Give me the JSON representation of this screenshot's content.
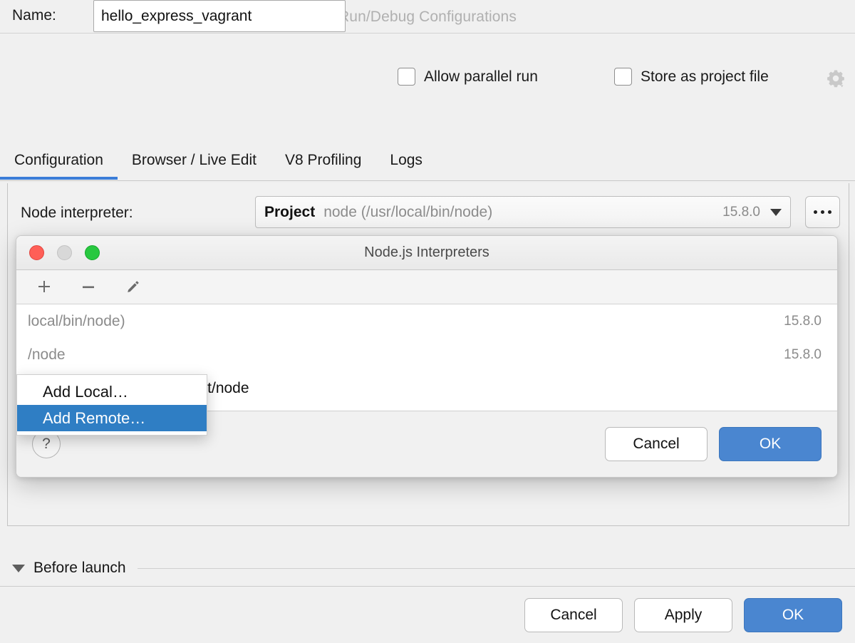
{
  "window": {
    "title": "Run/Debug Configurations"
  },
  "name_row": {
    "label": "Name:",
    "value": "hello_express_vagrant",
    "placeholder": "",
    "allow_parallel_run": "Allow parallel run",
    "store_as_project_file": "Store as project file",
    "gear_icon": "gear-icon"
  },
  "tabs": [
    {
      "label": "Configuration",
      "active": true
    },
    {
      "label": "Browser / Live Edit",
      "active": false
    },
    {
      "label": "V8 Profiling",
      "active": false
    },
    {
      "label": "Logs",
      "active": false
    }
  ],
  "configuration": {
    "node_interpreter_label": "Node interpreter:",
    "interpreter_scope": "Project",
    "interpreter_path": "node (/usr/local/bin/node)",
    "interpreter_version": "15.8.0",
    "browse_button": "...",
    "dropdown_icon": "chevron-down-icon"
  },
  "before_launch": {
    "label": "Before launch",
    "collapse_icon": "triangle-down-icon"
  },
  "main_footer": {
    "cancel": "Cancel",
    "apply": "Apply",
    "ok": "OK"
  },
  "modal": {
    "title": "Node.js Interpreters",
    "traffic_lights": {
      "close": "close-traffic-light",
      "minimize": "minimize-traffic-light",
      "zoom": "zoom-traffic-light"
    },
    "toolbar": {
      "add": "plus-icon",
      "remove": "minus-icon",
      "edit": "pencil-icon"
    },
    "list": [
      {
        "text": "local/bin/node)",
        "version": "15.8.0",
        "muted": true
      },
      {
        "text": "/node",
        "version": "15.8.0",
        "muted": true
      },
      {
        "text": "docker://node_docker:latest/node",
        "version": "",
        "muted": false
      }
    ],
    "help_button": "?",
    "cancel": "Cancel",
    "ok": "OK"
  },
  "popup_menu": {
    "items": [
      {
        "label": "Add Local…",
        "selected": false
      },
      {
        "label": "Add Remote…",
        "selected": true
      }
    ]
  },
  "colors": {
    "accent_blue": "#3b7dd8",
    "primary_button": "#4a86d0",
    "menu_highlight": "#2f7ec4",
    "background": "#f0f0f0",
    "muted_text": "#8b8b8b"
  }
}
